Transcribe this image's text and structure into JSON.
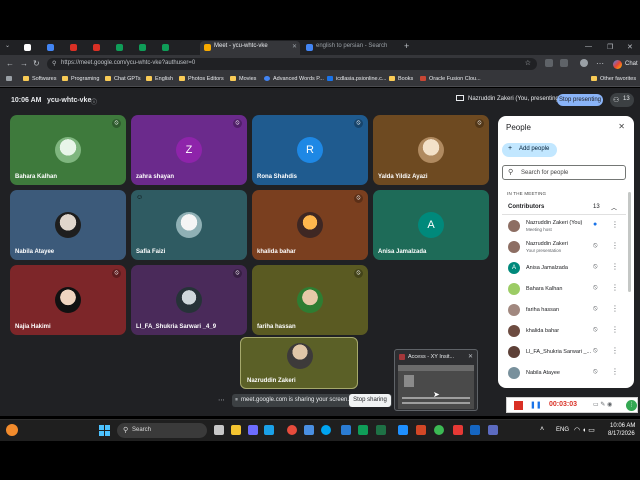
{
  "browser": {
    "tabs": [
      {
        "title": "",
        "color": "#ffffff"
      },
      {
        "title": "",
        "color": "#4285f4"
      },
      {
        "title": "",
        "color": "#d93025"
      },
      {
        "title": "",
        "color": "#d93025"
      },
      {
        "title": "",
        "color": "#0f9d58"
      },
      {
        "title": "",
        "color": "#0f9d58"
      },
      {
        "title": "",
        "color": "#0f9d58"
      },
      {
        "title": "Meet - ycu-whtc-vke",
        "color": "#f9ab00"
      },
      {
        "title": "english to persian - Search",
        "color": "#4285f4"
      }
    ],
    "new_tab": "+",
    "url": "https://meet.google.com/ycu-whtc-vke?authuser=0",
    "chat_label": "Chat",
    "bookmarks": [
      "Softwares",
      "Programing",
      "Chat GPTs",
      "English",
      "Photos Editors",
      "Movies",
      "Advanced Words P...",
      "icdlasia.psionline.c...",
      "Books",
      "Oracle Fusion Clou..."
    ],
    "other_favorites": "Other favorites"
  },
  "meet": {
    "time": "10:06 AM",
    "code": "ycu-whtc-vke",
    "presenting_banner": "Nazruddin Zakeri (You, presenting)",
    "stop_presenting": "Stop presenting",
    "participant_count": "13",
    "tiles": [
      {
        "name": "Bahara Kalhan",
        "bg": "#3e7a3c",
        "kind": "photo"
      },
      {
        "name": "zahra shayan",
        "bg": "#6b2a8c",
        "kind": "letter",
        "letter": "Z",
        "letter_bg": "#8e24aa"
      },
      {
        "name": "Rona Shahdis",
        "bg": "#1f5b8f",
        "kind": "letter",
        "letter": "R",
        "letter_bg": "#1e88e5"
      },
      {
        "name": "Yalda Yildiz Ayazi",
        "bg": "#6e4a21",
        "kind": "photo"
      },
      {
        "name": "Nabila Atayee",
        "bg": "#3c5a7a",
        "kind": "photo"
      },
      {
        "name": "Safia Faizi",
        "bg": "#2f5b62",
        "kind": "photo"
      },
      {
        "name": "khalida bahar",
        "bg": "#7a3f1f",
        "kind": "photo"
      },
      {
        "name": "Anisa Jamalzada",
        "bg": "#1e6b58",
        "kind": "letter",
        "letter": "A",
        "letter_bg": "#00897b"
      },
      {
        "name": "Najia Hakimi",
        "bg": "#7d2629",
        "kind": "photo"
      },
      {
        "name": "Ll_FA_Shukria Sarwari _4_9",
        "bg": "#4a2a5a",
        "kind": "photo"
      },
      {
        "name": "fariha hassan",
        "bg": "#5a5a22",
        "kind": "photo"
      }
    ],
    "presenter_name": "Nazruddin Zakeri",
    "share_text": "meet.google.com is sharing your screen.",
    "stop_sharing": "Stop sharing",
    "popup_title": "Access - XY Insit..."
  },
  "people": {
    "title": "People",
    "add_people": "Add people",
    "search_placeholder": "Search for people",
    "in_meeting": "IN THE MEETING",
    "contributors_label": "Contributors",
    "contributors_count": "13",
    "list": [
      {
        "name": "Nazruddin Zakeri (You)",
        "sub": "Meeting host",
        "color": "#8d6e63"
      },
      {
        "name": "Nazruddin Zakeri",
        "sub": "Your presentation",
        "color": "#8d6e63"
      },
      {
        "name": "Anisa Jamalzada",
        "sub": "",
        "color": "#00897b",
        "letter": "A"
      },
      {
        "name": "Bahara Kalhan",
        "sub": "",
        "color": "#9ccc65"
      },
      {
        "name": "fariha hassan",
        "sub": "",
        "color": "#a1887f"
      },
      {
        "name": "khalida bahar",
        "sub": "",
        "color": "#6d4c41"
      },
      {
        "name": "Ll_FA_Shukria Sarwari _...",
        "sub": "",
        "color": "#5d4037"
      },
      {
        "name": "Nabila Atayee",
        "sub": "",
        "color": "#78909c"
      }
    ]
  },
  "recorder": {
    "time": "00:03:03"
  },
  "taskbar": {
    "search_placeholder": "Search",
    "lang": "ENG",
    "time": "10:06 AM",
    "date": "8/17/2026"
  }
}
